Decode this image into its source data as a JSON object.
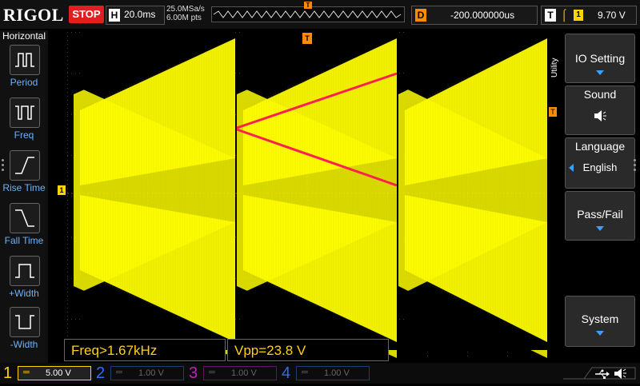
{
  "header": {
    "brand": "RIGOL",
    "run_state": "STOP",
    "horizontal": {
      "badge": "H",
      "timebase": "20.0ms"
    },
    "acquisition": {
      "sample_rate": "25.0MSa/s",
      "memory_depth": "6.00M pts"
    },
    "trigger_position_marker": "T",
    "delay": {
      "badge": "D",
      "value": "-200.000000us"
    },
    "trigger": {
      "badge": "T",
      "edge_symbol": "⌠",
      "source": "1",
      "level": "9.70 V"
    }
  },
  "left_menu": {
    "title": "Horizontal",
    "items": [
      {
        "label": "Period",
        "icon": "period-icon"
      },
      {
        "label": "Freq",
        "icon": "frequency-icon"
      },
      {
        "label": "Rise Time",
        "icon": "rise-time-icon"
      },
      {
        "label": "Fall Time",
        "icon": "fall-time-icon"
      },
      {
        "label": "+Width",
        "icon": "positive-width-icon"
      },
      {
        "label": "-Width",
        "icon": "negative-width-icon"
      }
    ]
  },
  "graticule": {
    "channel1_marker": "1",
    "trigger_level_marker": "T",
    "time_marker": "T"
  },
  "measurements": [
    {
      "text": "Freq>1.67kHz"
    },
    {
      "text": "Vpp=23.8 V"
    }
  ],
  "right_menu": {
    "section": "Utility",
    "io_setting": {
      "title": "IO Setting"
    },
    "sound": {
      "title": "Sound",
      "icon": "speaker-icon"
    },
    "language": {
      "title": "Language",
      "value": "English"
    },
    "pass_fail": {
      "title": "Pass/Fail"
    },
    "system": {
      "title": "System"
    }
  },
  "channels": [
    {
      "number": "1",
      "coupling": "═",
      "scale": "5.00 V",
      "color": "#ffd400",
      "active": true
    },
    {
      "number": "2",
      "coupling": "═",
      "scale": "1.00 V",
      "color": "#2f6fff",
      "active": false
    },
    {
      "number": "3",
      "coupling": "═",
      "scale": "1.00 V",
      "color": "#c21fc2",
      "active": false
    },
    {
      "number": "4",
      "coupling": "═",
      "scale": "1.00 V",
      "color": "#2a6fe0",
      "active": false
    }
  ],
  "status_icons": [
    "usb-icon",
    "speaker-icon"
  ],
  "colors": {
    "trace": "#ffff00",
    "annotation": "#ff2050",
    "accent": "#ff8c00",
    "menu_text": "#6ab3ff"
  }
}
